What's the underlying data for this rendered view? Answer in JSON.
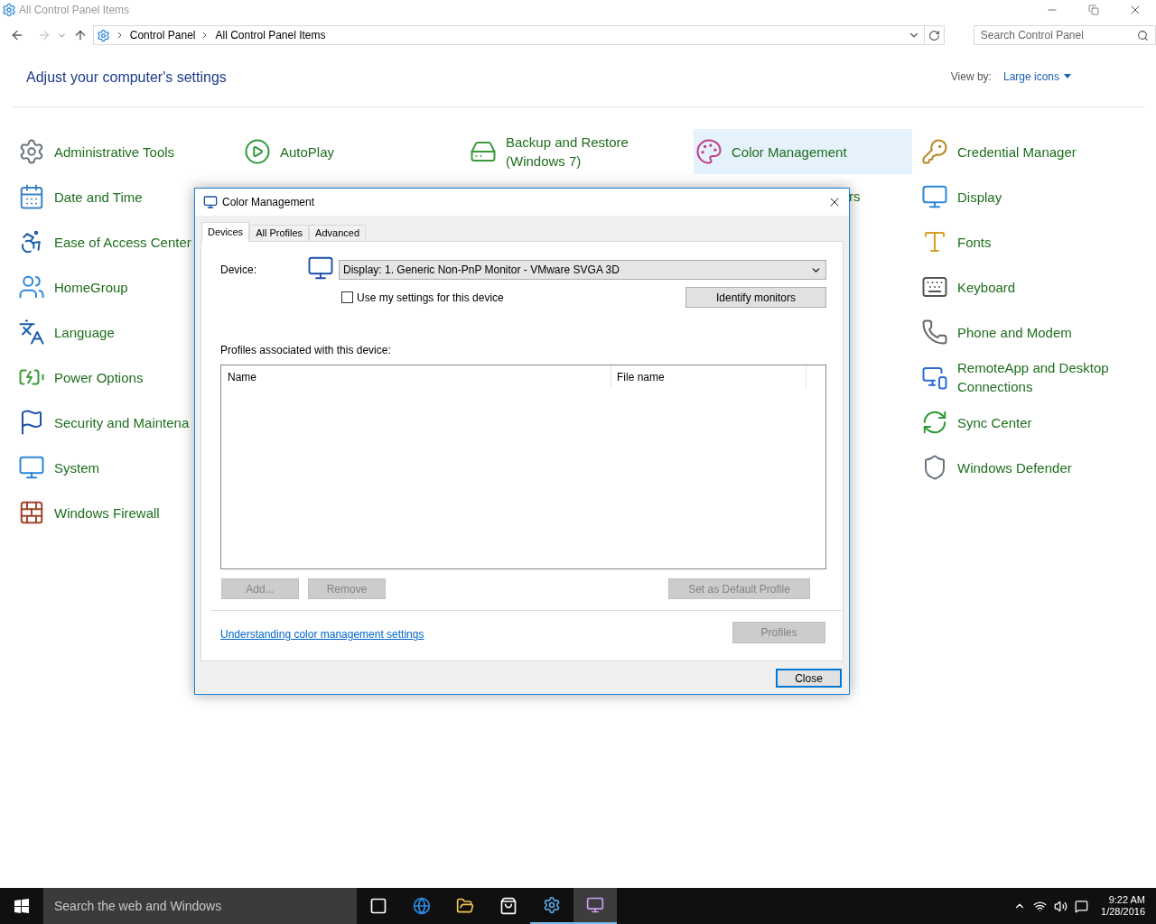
{
  "window": {
    "title": "All Control Panel Items"
  },
  "address_bar": {
    "breadcrumbs": [
      "Control Panel",
      "All Control Panel Items"
    ]
  },
  "search": {
    "placeholder": "Search Control Panel"
  },
  "heading": "Adjust your computer's settings",
  "view_by": {
    "label": "View by:",
    "value": "Large icons"
  },
  "columns": [
    [
      {
        "label": "Administrative Tools",
        "selected": false,
        "kind": "link"
      },
      {
        "label": "Date and Time",
        "selected": false,
        "kind": "link"
      },
      {
        "label": "Ease of Access Center",
        "selected": false,
        "kind": "link"
      },
      {
        "label": "HomeGroup",
        "selected": false,
        "kind": "link"
      },
      {
        "label": "Language",
        "selected": false,
        "kind": "link"
      },
      {
        "label": "Power Options",
        "selected": false,
        "kind": "link"
      },
      {
        "label": "Security and Maintena",
        "selected": false,
        "kind": "link"
      },
      {
        "label": "System",
        "selected": false,
        "kind": "link"
      },
      {
        "label": "Windows Firewall",
        "selected": false,
        "kind": "link"
      }
    ],
    [
      {
        "label": "AutoPlay",
        "selected": false,
        "kind": "link"
      }
    ],
    [
      {
        "label": "Backup and Restore (Windows 7)",
        "selected": false,
        "kind": "link"
      }
    ],
    [
      {
        "label": "Color Management",
        "selected": true,
        "kind": "link"
      },
      {
        "label": "rs",
        "selected": false,
        "kind": "clipped"
      }
    ],
    [
      {
        "label": "Credential Manager",
        "selected": false,
        "kind": "link"
      },
      {
        "label": "Display",
        "selected": false,
        "kind": "link"
      },
      {
        "label": "Fonts",
        "selected": false,
        "kind": "link"
      },
      {
        "label": "Keyboard",
        "selected": false,
        "kind": "link"
      },
      {
        "label": "Phone and Modem",
        "selected": false,
        "kind": "link"
      },
      {
        "label": "RemoteApp and Desktop Connections",
        "selected": false,
        "kind": "link"
      },
      {
        "label": "Sync Center",
        "selected": false,
        "kind": "link"
      },
      {
        "label": "Windows Defender",
        "selected": false,
        "kind": "link"
      }
    ]
  ],
  "dialog": {
    "title": "Color Management",
    "tabs": [
      {
        "label": "Devices",
        "selected": true
      },
      {
        "label": "All Profiles",
        "selected": false
      },
      {
        "label": "Advanced",
        "selected": false
      }
    ],
    "device_label": "Device:",
    "device_value": "Display: 1. Generic Non-PnP Monitor - VMware SVGA 3D",
    "use_my_settings": {
      "label": "Use my settings for this device",
      "checked": false
    },
    "identify_button": {
      "label": "Identify monitors",
      "disabled": false
    },
    "profiles_label": "Profiles associated with this device:",
    "list_columns": [
      "Name",
      "File name"
    ],
    "buttons": [
      {
        "label": "Add...",
        "disabled": true
      },
      {
        "label": "Remove",
        "disabled": true
      },
      {
        "label": "Set as Default Profile",
        "disabled": true
      }
    ],
    "link": "Understanding color management settings",
    "profiles_button": {
      "label": "Profiles",
      "disabled": true
    },
    "close_button": {
      "label": "Close",
      "disabled": false
    }
  },
  "taskbar": {
    "search_placeholder": "Search the web and Windows",
    "apps": [
      {
        "active": false,
        "focused": false
      },
      {
        "active": false,
        "focused": false
      },
      {
        "active": false,
        "focused": false
      },
      {
        "active": false,
        "focused": false
      },
      {
        "active": true,
        "focused": false
      },
      {
        "active": true,
        "focused": true
      }
    ],
    "time": "9:22 AM",
    "date": "1/28/2016"
  }
}
